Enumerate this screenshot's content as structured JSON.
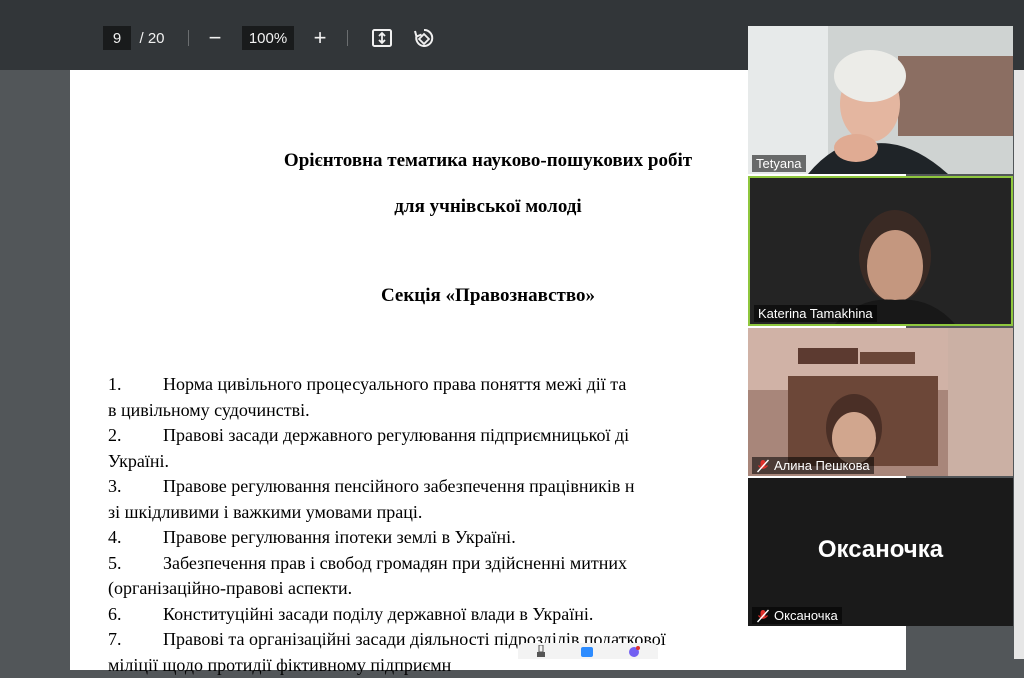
{
  "toolbar": {
    "page_current": "9",
    "page_total": "/ 20",
    "zoom_out_label": "−",
    "zoom_value": "100%",
    "zoom_in_label": "+",
    "icons": [
      "fit-page-icon",
      "rotate-icon"
    ]
  },
  "document": {
    "title_line1": "Орієнтовна тематика науково-пошукових робіт",
    "title_line2": "для учнівської молоді",
    "section": "Секція «Правознавство»",
    "items": [
      {
        "num": "1.",
        "text": "Норма цивільного процесуального права поняття межі дії та"
      },
      {
        "num": "",
        "text": "в цивільному судочинстві."
      },
      {
        "num": "2.",
        "text": "Правові засади державного регулювання підприємницької ді"
      },
      {
        "num": "",
        "text": "Україні."
      },
      {
        "num": "3.",
        "text": "Правове регулювання пенсійного забезпечення працівників н"
      },
      {
        "num": "",
        "text": "зі шкідливими і важкими умовами праці."
      },
      {
        "num": "4.",
        "text": "Правове регулювання іпотеки землі в Україні."
      },
      {
        "num": "5.",
        "text": "Забезпечення прав і свобод громадян при здійсненні митних"
      },
      {
        "num": "",
        "text": "(організаційно-правові аспекти."
      },
      {
        "num": "6.",
        "text": "Конституційні засади поділу державної влади в Україні."
      },
      {
        "num": "7.",
        "text": "Правові та організаційні засади діяльності підрозділів податкової"
      },
      {
        "num": "",
        "text": "міліції щодо протидії фіктивному підприємн"
      }
    ]
  },
  "participants": [
    {
      "name": "Tetyana",
      "muted": false,
      "active": false
    },
    {
      "name": "Katerina Tamakhina",
      "muted": false,
      "active": true
    },
    {
      "name": "Алина Пешкова",
      "muted": true,
      "active": false
    },
    {
      "name": "Оксаночка",
      "muted": true,
      "active": false,
      "display_text": "Оксаночка"
    }
  ],
  "colors": {
    "toolbar_bg": "#323639",
    "viewer_bg": "#525659",
    "active_speaker_border": "#8fc73e",
    "muted_icon": "#e0302b"
  }
}
